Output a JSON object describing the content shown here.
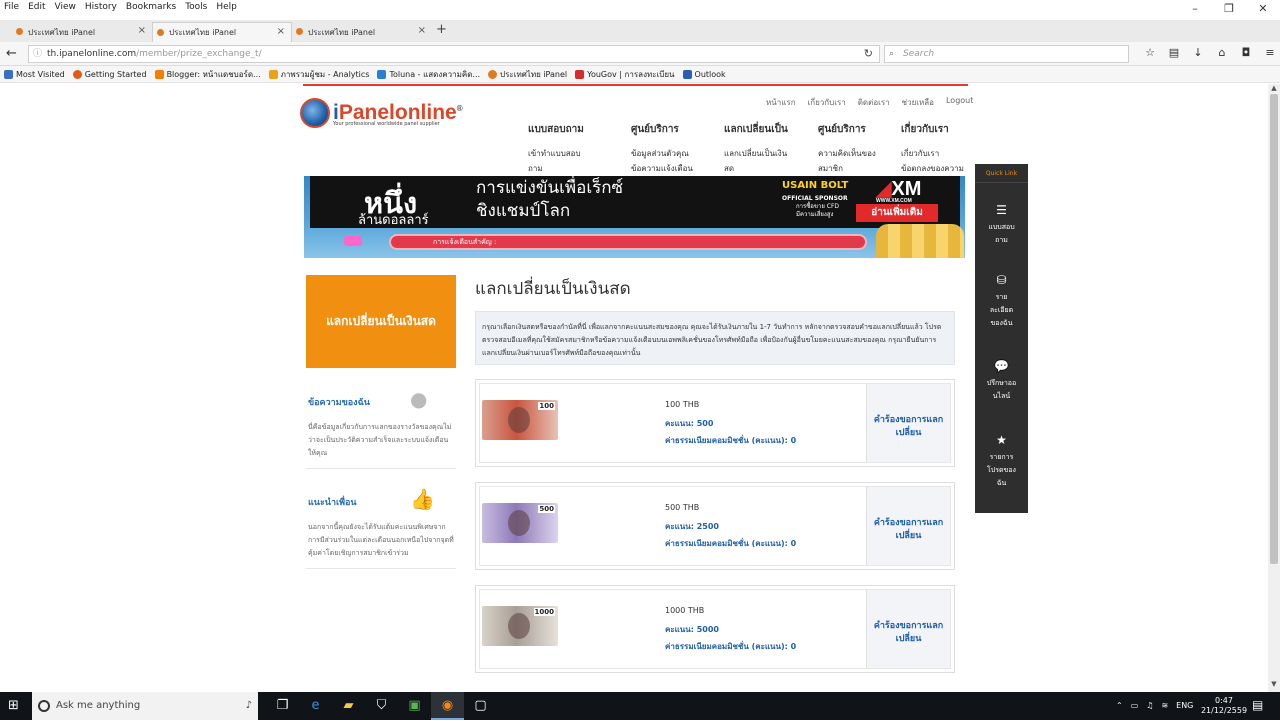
{
  "browser": {
    "menu": [
      "File",
      "Edit",
      "View",
      "History",
      "Bookmarks",
      "Tools",
      "Help"
    ],
    "window_controls": [
      "–",
      "❐",
      "✕"
    ],
    "tabs": [
      {
        "label": "ประเทศไทย iPanel"
      },
      {
        "label": "ประเทศไทย iPanel"
      },
      {
        "label": "ประเทศไทย iPanel"
      }
    ],
    "new_tab": "+",
    "url_host": "th.ipanelonline.com",
    "url_path": "/member/prize_exchange_t/",
    "search_placeholder": "Search",
    "bookmarks": [
      {
        "label": "Most Visited",
        "color": "#3a6fc4"
      },
      {
        "label": "Getting Started",
        "color": "#e05a1a"
      },
      {
        "label": "Blogger: หน้าแดชบอร์ด...",
        "color": "#f57d00"
      },
      {
        "label": "ภาพรวมผู้ชม - Analytics",
        "color": "#e8a317"
      },
      {
        "label": "Toluna - แสดงความคิด...",
        "color": "#2a7fd1"
      },
      {
        "label": "ประเทศไทย iPanel",
        "color": "#e07a20"
      },
      {
        "label": "YouGov | การลงทะเบียน",
        "color": "#d62b2b"
      },
      {
        "label": "Outlook",
        "color": "#2a5fb8"
      }
    ]
  },
  "site": {
    "logo_i": "i",
    "logo_rest": "Panelonline",
    "logo_reg": "®",
    "logo_tagline": "Your professional worldwide panel supplier",
    "top_links": [
      "หน้าแรก",
      "เกี่ยวกับเรา",
      "ติดต่อเรา",
      "ช่วยเหลือ",
      "Logout"
    ],
    "nav": [
      {
        "head": "แบบสอบถาม",
        "sub1": "เข้าทำแบบสอบ",
        "sub2": "ถาม"
      },
      {
        "head": "ศูนย์บริการ",
        "sub1": "ข้อมูลส่วนตัวคุณ",
        "sub2": "ข้อความแจ้งเตือน"
      },
      {
        "head": "แลกเปลี่ยนเป็น",
        "sub1": "แลกเปลี่ยนเป็นเงิน",
        "sub2": "สด"
      },
      {
        "head": "ศูนย์บริการ",
        "sub1": "ความคิดเห็นของ",
        "sub2": "สมาชิก"
      },
      {
        "head": "เกี่ยวกับเรา",
        "sub1": "เกี่ยวกับเรา",
        "sub2": "ข้อตกลงของความ"
      }
    ],
    "banner": {
      "big": "หนึ่ง",
      "million": "ล้านดอลลาร์",
      "race_line1": "การแข่งขันเพื่อเร็กซ์",
      "race_line2": "ชิงแชมป์โลก",
      "bolt": "USAIN BOLT",
      "sponsor": "OFFICIAL SPONSOR",
      "cfd_line1": "การซื้อขาย CFD",
      "cfd_line2": "มีความเสี่ยงสูง",
      "xm": "XM",
      "xm_url": "WWW.XM.COM",
      "more": "อ่านเพิ่มเติม",
      "notice": "การแจ้งเตือนสำคัญ :"
    },
    "sidebar": {
      "orange_title": "แลกเปลี่ยนเป็นเงินสด",
      "messages_title": "ข้อความของฉัน",
      "messages_text": "นี่คือข้อมูลเกี่ยวกับการแลกของรางวัลของคุณไม่ว่าจะเป็นประวัติความสำเร็จและระบบแจ้งเตือนให้คุณ",
      "refer_title": "แนะนำเพื่อน",
      "refer_text": "นอกจากนี้คุณยังจะได้รับแต้มคะแนนพิเศษจากการมีส่วนร่วมในแต่ละเดือนนอกเหนือไปจากจุดที่คุ้มค่าโดยเชิญการสมาชิกเข้าร่วม"
    },
    "content": {
      "title": "แลกเปลี่ยนเป็นเงินสด",
      "intro": "กรุณาเลือกเงินสดหรือของกำนัลที่นี่ เพื่อแลกจากคะแนนสะสมของคุณ คุณจะได้รับเงินภายใน 1-7 วันทำการ หลักจากตรวจสอบคำขอแลกเปลี่ยนแล้ว โปรดตรวจสอบอีเมลที่คุณใช้สมัครสมาชิกหรือข้อความแจ้งเตือนบนเอพพลิเคชั่นของโทรศัพท์มือถือ เพื่อป้องกันผู้อื่นขโมยคะแนนสะสมของคุณ กรุณายืนยันการแลกเปลี่ยนเงินผ่านเบอร์โทรศัพท์มือถือของคุณเท่านั้น",
      "prizes": [
        {
          "name": "100 THB",
          "points": "คะแนน: 500",
          "fee": "ค่าธรรมเนียมคอมมิชชั่น (คะแนน): 0",
          "note_label": "100",
          "note_color": "#c9543f",
          "redeem": "คำร้องขอการแลกเปลี่ยน"
        },
        {
          "name": "500 THB",
          "points": "คะแนน: 2500",
          "fee": "ค่าธรรมเนียมคอมมิชชั่น (คะแนน): 0",
          "note_label": "500",
          "note_color": "#8d79b8",
          "redeem": "คำร้องขอการแลกเปลี่ยน"
        },
        {
          "name": "1000 THB",
          "points": "คะแนน: 5000",
          "fee": "ค่าธรรมเนียมคอมมิชชั่น (คะแนน): 0",
          "note_label": "1000",
          "note_color": "#a89f96",
          "redeem": "คำร้องขอการแลกเปลี่ยน"
        }
      ]
    },
    "quicklink": {
      "title": "Quick Link",
      "items": [
        {
          "icon": "☰",
          "label1": "แบบสอบ",
          "label2": "ถาม"
        },
        {
          "icon": "⛁",
          "label1": "ราย",
          "label2": "ละเอียด",
          "label3": "ของฉัน"
        },
        {
          "icon": "💬",
          "label1": "ปรึกษาออ",
          "label2": "นไลน์"
        },
        {
          "icon": "★",
          "label1": "รายการ",
          "label2": "โปรดของ",
          "label3": "ฉัน"
        }
      ]
    }
  },
  "taskbar": {
    "search_placeholder": "Ask me anything",
    "lang": "ENG",
    "time": "0:47",
    "date": "21/12/2559"
  }
}
